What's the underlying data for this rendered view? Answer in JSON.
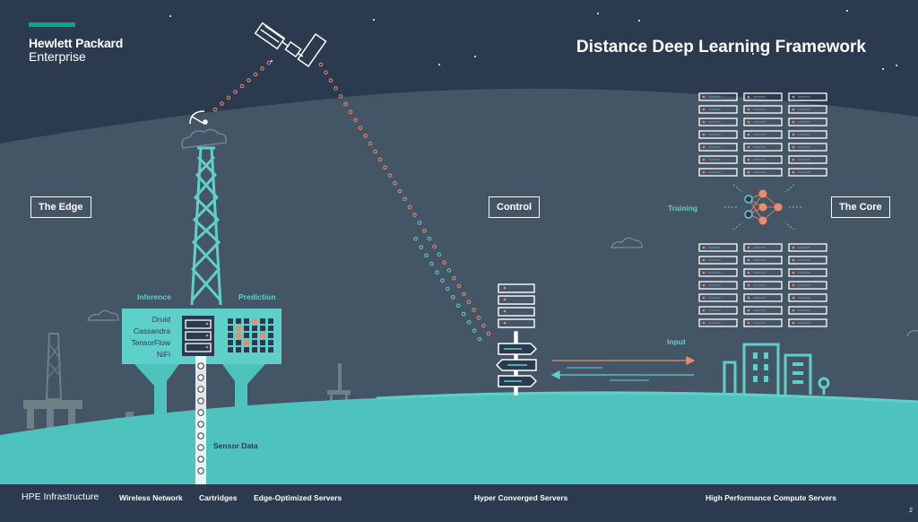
{
  "brand": {
    "line1": "Hewlett Packard",
    "line2": "Enterprise",
    "bar_color": "#01a982"
  },
  "title": "Distance Deep Learning Framework",
  "zones": {
    "edge": "The Edge",
    "control": "Control",
    "core": "The Core"
  },
  "labels": {
    "inference": "Inference",
    "prediction": "Prediction",
    "training": "Training",
    "input": "Input",
    "sensor_data": "Sensor Data"
  },
  "databases": [
    "Druid",
    "Cassandra",
    "TensorFlow",
    "NiFi"
  ],
  "footer": {
    "main": "HPE Infrastructure",
    "items": [
      "Wireless Network",
      "Cartridges",
      "Edge-Optimized Servers",
      "Hyper Converged Servers",
      "High Performance Compute Servers"
    ]
  },
  "page_number": "2",
  "colors": {
    "sky": "#2b3a4f",
    "hill": "#445566",
    "teal": "#5fd0c9",
    "coral": "#f08a6c",
    "ground": "#4ec3bd"
  },
  "icons": [
    "satellite-icon",
    "satellite-dish-icon",
    "cloud-icon",
    "server-rack-icon",
    "neural-network-icon",
    "signpost-icon",
    "city-buildings-icon",
    "oil-rig-icon",
    "ship-icon"
  ]
}
